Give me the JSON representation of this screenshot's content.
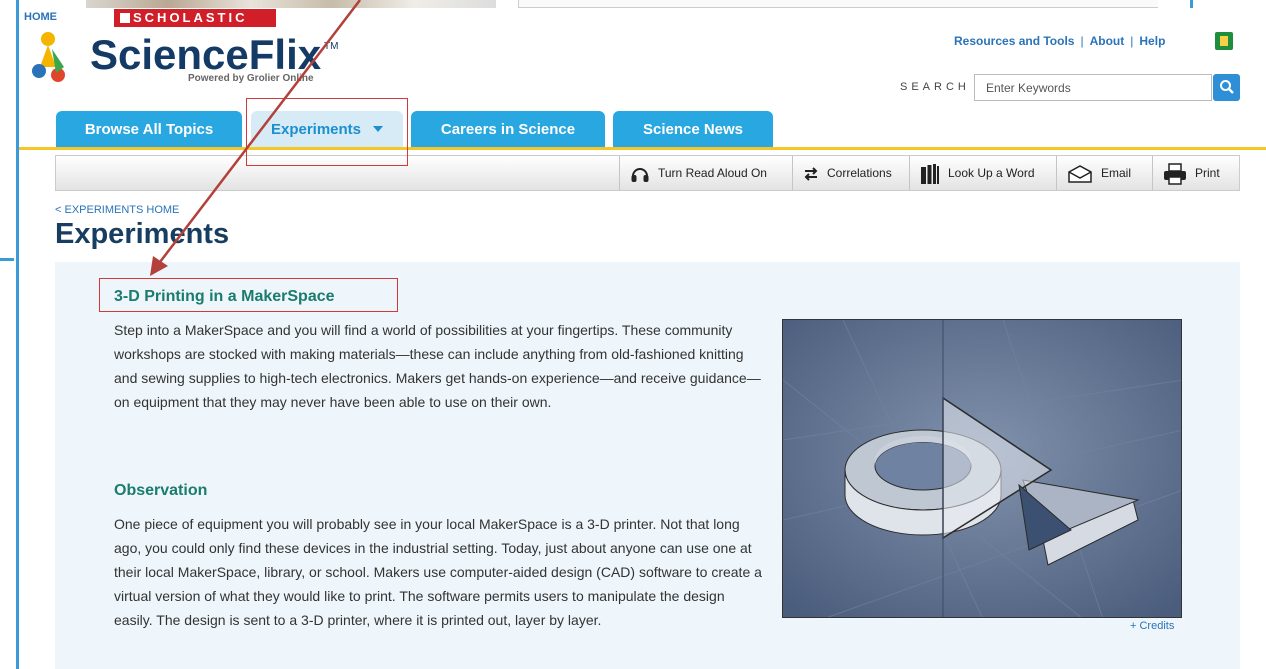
{
  "header": {
    "home_link": "HOME",
    "scholastic": "SCHOLASTIC",
    "logo_text": "ScienceFlix",
    "logo_tm": "TM",
    "logo_sub": "Powered by Grolier Online",
    "util_links": [
      "Resources and Tools",
      "About",
      "Help"
    ],
    "search_label": "SEARCH",
    "search_placeholder": "Enter Keywords"
  },
  "tabs": [
    {
      "label": "Browse All Topics"
    },
    {
      "label": "Experiments"
    },
    {
      "label": "Careers in Science"
    },
    {
      "label": "Science News"
    }
  ],
  "toolbar": {
    "read_aloud": "Turn Read Aloud On",
    "correlations": "Correlations",
    "lookup": "Look Up a Word",
    "email": "Email",
    "print": "Print"
  },
  "breadcrumb": "< EXPERIMENTS HOME",
  "page_title": "Experiments",
  "article": {
    "title": "3-D Printing in a MakerSpace",
    "intro": "Step into a MakerSpace and you will find a world of possibilities at your fingertips. These community workshops are stocked with making materials—these can include anything from old-fashioned knitting and sewing supplies to high-tech electronics. Makers get hands-on experience—and receive guidance—on equipment that they may never have been able to use on their own.",
    "observation_heading": "Observation",
    "observation": "One piece of equipment you will probably see in your local MakerSpace is a 3-D printer. Not that long ago, you could only find these devices in the industrial setting. Today, just about anyone can use one at their local MakerSpace, library, or school. Makers use computer-aided design (CAD) software to create a virtual version of what they would like to print. The software permits users to manipulate the design easily. The design is sent to a 3-D printer, where it is printed out, layer by layer.",
    "credits": "+ Credits"
  },
  "colors": {
    "tab_blue": "#29a7e1",
    "tab_active": "#d6ebf6",
    "accent_yellow": "#f4c627",
    "title_green": "#1b7c6d",
    "annotation_red": "#d03a3a"
  }
}
